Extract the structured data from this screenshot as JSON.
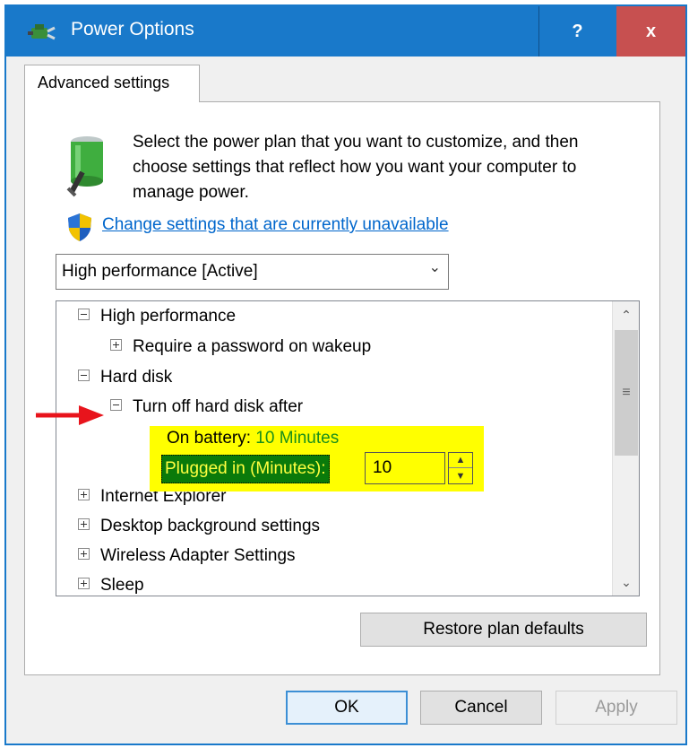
{
  "window": {
    "title": "Power Options",
    "help_label": "?",
    "close_label": "x"
  },
  "tabs": [
    {
      "label": "Advanced settings"
    }
  ],
  "intro": {
    "text": "Select the power plan that you want to customize, and then choose settings that reflect how you want your computer to manage power.",
    "change_link": "Change settings that are currently unavailable"
  },
  "plan_select": {
    "value": "High performance [Active]"
  },
  "tree": {
    "items": [
      {
        "label": "High performance",
        "expander": "minus"
      },
      {
        "label": "Require a password on wakeup",
        "expander": "plus"
      },
      {
        "label": "Hard disk",
        "expander": "minus"
      },
      {
        "label": "Turn off hard disk after",
        "expander": "minus"
      },
      {
        "label": "Internet Explorer",
        "expander": "plus"
      },
      {
        "label": "Desktop background settings",
        "expander": "plus"
      },
      {
        "label": "Wireless Adapter Settings",
        "expander": "plus"
      },
      {
        "label": "Sleep",
        "expander": "plus"
      }
    ],
    "on_battery_label": "On battery:",
    "on_battery_value": "10 Minutes",
    "plugged_in_label": "Plugged in (Minutes):",
    "plugged_in_value": "10"
  },
  "buttons": {
    "restore": "Restore plan defaults",
    "ok": "OK",
    "cancel": "Cancel",
    "apply": "Apply"
  },
  "colors": {
    "titlebar": "#1979ca",
    "close": "#c75050",
    "highlight": "#ffff00",
    "link": "#0066cc",
    "annotation_arrow": "#e8141c"
  }
}
